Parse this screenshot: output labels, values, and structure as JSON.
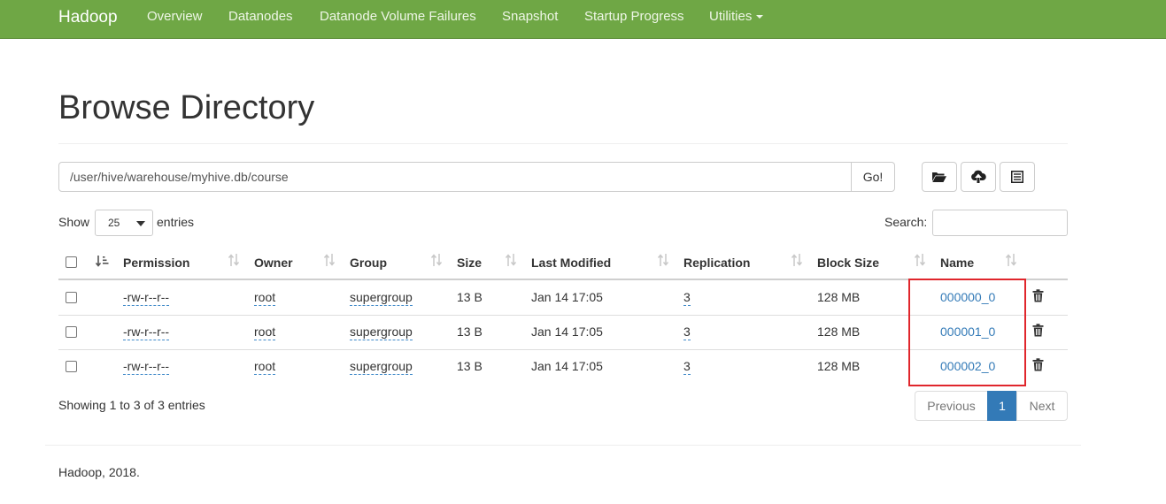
{
  "navbar": {
    "brand": "Hadoop",
    "items": [
      "Overview",
      "Datanodes",
      "Datanode Volume Failures",
      "Snapshot",
      "Startup Progress",
      "Utilities"
    ]
  },
  "page": {
    "title": "Browse Directory"
  },
  "path": {
    "value": "/user/hive/warehouse/myhive.db/course",
    "go_label": "Go!"
  },
  "toolbar_icons": [
    "folder-open-icon",
    "upload-icon",
    "list-alt-icon"
  ],
  "length": {
    "show_label": "Show",
    "value": "25",
    "entries_label": "entries"
  },
  "search": {
    "label": "Search:",
    "value": ""
  },
  "table": {
    "headers": [
      "Permission",
      "Owner",
      "Group",
      "Size",
      "Last Modified",
      "Replication",
      "Block Size",
      "Name"
    ],
    "rows": [
      {
        "permission": "-rw-r--r--",
        "owner": "root",
        "group": "supergroup",
        "size": "13 B",
        "modified": "Jan 14 17:05",
        "replication": "3",
        "block_size": "128 MB",
        "name": "000000_0"
      },
      {
        "permission": "-rw-r--r--",
        "owner": "root",
        "group": "supergroup",
        "size": "13 B",
        "modified": "Jan 14 17:05",
        "replication": "3",
        "block_size": "128 MB",
        "name": "000001_0"
      },
      {
        "permission": "-rw-r--r--",
        "owner": "root",
        "group": "supergroup",
        "size": "13 B",
        "modified": "Jan 14 17:05",
        "replication": "3",
        "block_size": "128 MB",
        "name": "000002_0"
      }
    ]
  },
  "info": "Showing 1 to 3 of 3 entries",
  "pagination": {
    "previous": "Previous",
    "current": "1",
    "next": "Next"
  },
  "footer": "Hadoop, 2018.",
  "colors": {
    "navbar": "#6fa745",
    "link": "#337ab7",
    "highlight": "#e0262c"
  }
}
